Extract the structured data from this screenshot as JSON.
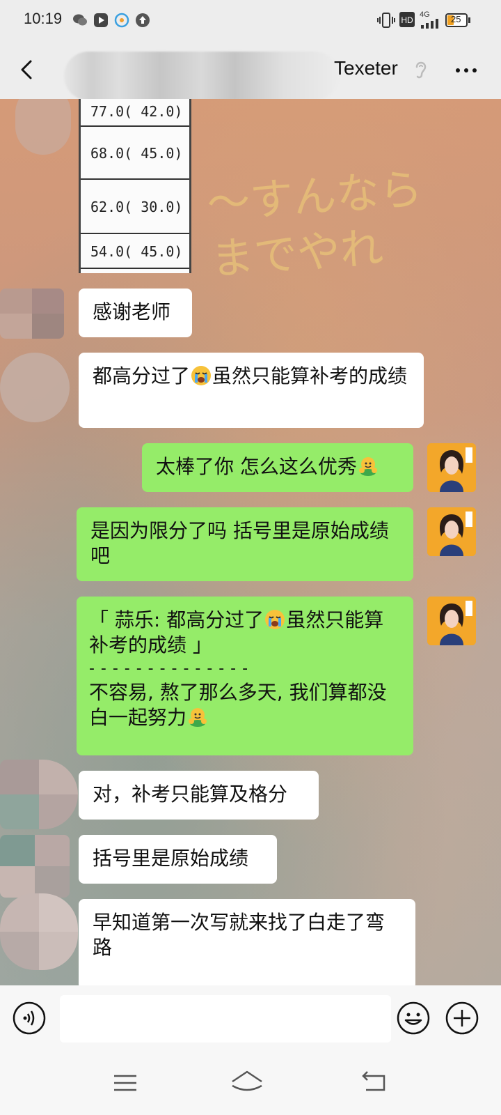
{
  "status_bar": {
    "time": "10:19",
    "network": "4G",
    "battery": "25",
    "hd_label": "HD"
  },
  "header": {
    "title_suffix": "Texeter",
    "back_icon": "chevron-left-icon",
    "more_icon": "more-dots-icon"
  },
  "score_image": {
    "rows": [
      "77.0( 42.0)",
      "68.0( 45.0)",
      "62.0( 30.0)",
      "54.0( 45.0)"
    ]
  },
  "messages": [
    {
      "side": "left",
      "text": "感谢老师"
    },
    {
      "side": "left",
      "text_a": "都高分过了",
      "text_b": "虽然只能算补考的成绩"
    },
    {
      "side": "right",
      "text": "太棒了你 怎么这么优秀"
    },
    {
      "side": "right",
      "text": "是因为限分了吗  括号里是原始成绩吧"
    },
    {
      "side": "right",
      "quote_a": "「 蒜乐: 都高分过了",
      "quote_b": "虽然只能算补考的成绩 」",
      "divider": "- - - - - - - - - - - - - -",
      "reply": "不容易, 熬了那么多天, 我们算都没白一起努力"
    },
    {
      "side": "left",
      "text": "对，补考只能算及格分"
    },
    {
      "side": "left",
      "text": "括号里是原始成绩"
    },
    {
      "side": "left",
      "text": "早知道第一次写就来找了白走了弯路"
    }
  ],
  "input_bar": {
    "voice_icon": "voice-icon",
    "emoji_icon": "emoji-icon",
    "plus_icon": "plus-icon",
    "placeholder": ""
  },
  "nav": {
    "menu_icon": "menu-icon",
    "home_icon": "home-icon",
    "back_icon": "back-icon"
  },
  "colors": {
    "green_bubble": "#95ec69",
    "white_bubble": "#ffffff",
    "background": "#ededed"
  }
}
